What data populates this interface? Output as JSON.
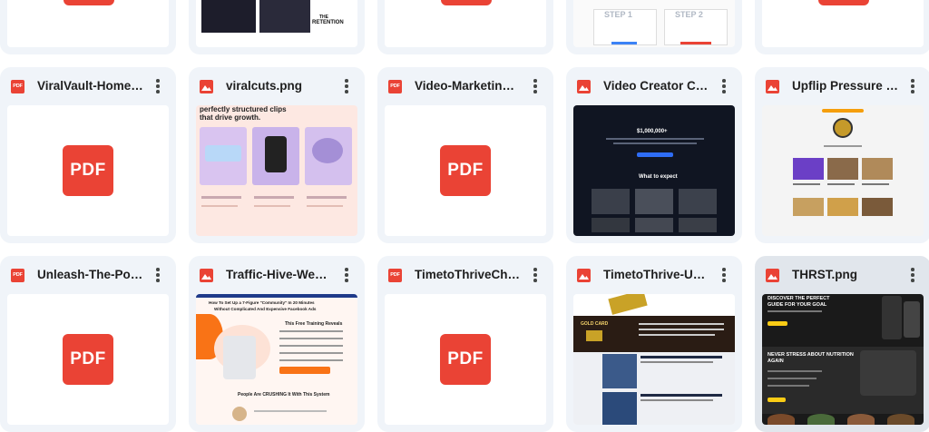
{
  "files": [
    {
      "name": "ViralVault-Home…",
      "type": "pdf"
    },
    {
      "name": "viralcuts.png",
      "type": "image"
    },
    {
      "name": "Video-Marketin…",
      "type": "pdf"
    },
    {
      "name": "Video Creator C…",
      "type": "image"
    },
    {
      "name": "Upflip Pressure …",
      "type": "image"
    },
    {
      "name": "Unleash-The-Po…",
      "type": "pdf"
    },
    {
      "name": "Traffic-Hive-We…",
      "type": "image"
    },
    {
      "name": "TimetoThriveCh…",
      "type": "pdf"
    },
    {
      "name": "TimetoThrive-U…",
      "type": "image"
    },
    {
      "name": "THRST.png",
      "type": "image",
      "selected": true
    }
  ],
  "pdf_badge_label": "PDF",
  "pdf_icon_label": "PDF",
  "thumb_text": {
    "viralcuts_headline": "perfectly structured clips",
    "viralcuts_headline2": "that drive growth.",
    "retention_1": "THE",
    "retention_2": "RETENTION",
    "step1": "STEP 1",
    "step2": "STEP 2",
    "vc_price": "$1,000,000+",
    "vc_expect": "What to expect",
    "traffic_title": "How To Set Up a 7-Figure \"Community\" In 20 Minutes",
    "traffic_title2": "Without Complicated And Expensive Facebook Ads",
    "traffic_reveals": "This Free Training Reveals",
    "traffic_crushing": "People Are CRUSHING It With This System",
    "ttu_gold": "GOLD CARD",
    "thrst_head1": "DISCOVER THE PERFECT",
    "thrst_head2": "GUIDE FOR YOUR GOAL",
    "thrst_head3": "NEVER STRESS ABOUT NUTRITION",
    "thrst_head4": "AGAIN"
  },
  "colors": {
    "card_bg": "#f0f4f9",
    "card_selected_bg": "#e1e6ec",
    "pdf_red": "#ea4335",
    "image_red": "#ea4335"
  }
}
